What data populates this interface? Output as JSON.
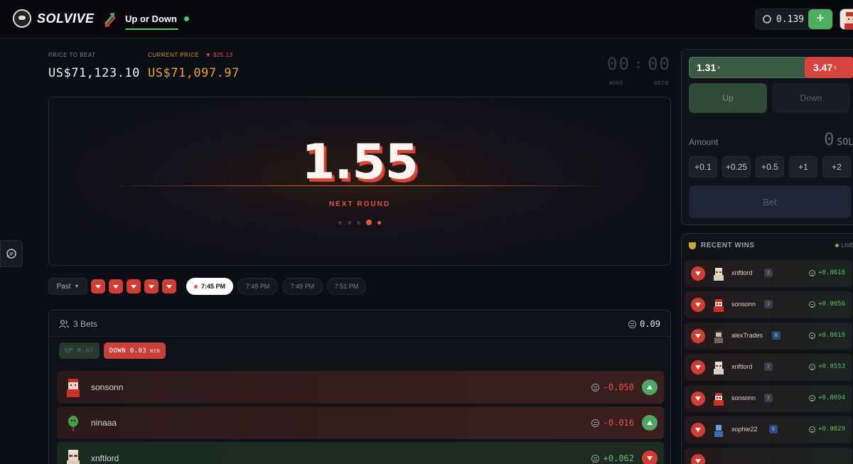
{
  "header": {
    "logo_text": "SOLVIVE",
    "game_title": "Up or Down",
    "wallet_balance": "0.139",
    "add_label": "+"
  },
  "prices": {
    "price_to_beat_label": "PRICE TO BEAT",
    "price_to_beat": "US$71,123.10",
    "current_price_label": "CURRENT PRICE",
    "current_price_change": "$25.13",
    "current_price": "US$71,097.97"
  },
  "timer": {
    "mins": "00",
    "secs": "00",
    "separator": ":",
    "mins_label": "MINS",
    "secs_label": "SECS"
  },
  "round": {
    "multiplier": "1.55",
    "status": "NEXT ROUND"
  },
  "rounds_strip": {
    "past_label": "Past",
    "past_results": [
      "down",
      "down",
      "down",
      "down",
      "down"
    ],
    "times": [
      {
        "label": "7:45 PM",
        "active": true
      },
      {
        "label": "7:48 PM",
        "active": false
      },
      {
        "label": "7:49 PM",
        "active": false
      },
      {
        "label": "7:51 PM",
        "active": false
      }
    ]
  },
  "bets": {
    "count_label": "3 Bets",
    "total": "0.09",
    "up_tag": "UP 0.07",
    "down_tag": "DOWN 0.03",
    "down_tag_win": "WIN",
    "rows": [
      {
        "name": "sonsonn",
        "amount": "-0.050",
        "side": "down",
        "direction": "up"
      },
      {
        "name": "ninaaa",
        "amount": "-0.016",
        "side": "down",
        "direction": "up"
      },
      {
        "name": "xnftlord",
        "amount": "+0.062",
        "side": "up",
        "direction": "down"
      }
    ]
  },
  "side_panel": {
    "up_multiplier": "1.31",
    "down_multiplier": "3.47",
    "mult_suffix": "x",
    "up_label": "Up",
    "down_label": "Down",
    "amount_label": "Amount",
    "amount_value": "0",
    "amount_unit": "SOL",
    "quick_amounts": [
      "+0.1",
      "+0.25",
      "+0.5",
      "+1",
      "+2"
    ],
    "bet_label": "Bet"
  },
  "recent_wins": {
    "title": "RECENT WINS",
    "live_label": "LIVE",
    "rows": [
      {
        "name": "xnftlord",
        "level": "2",
        "amount": "+0.0618",
        "level_color": "gray"
      },
      {
        "name": "sonsonn",
        "level": "2",
        "amount": "+0.0056",
        "level_color": "gray"
      },
      {
        "name": "alexTrades",
        "level": "6",
        "amount": "+0.0019",
        "level_color": "blue"
      },
      {
        "name": "xnftlord",
        "level": "2",
        "amount": "+0.0553",
        "level_color": "gray"
      },
      {
        "name": "sonsonn",
        "level": "2",
        "amount": "+0.0094",
        "level_color": "gray"
      },
      {
        "name": "sophie22",
        "level": "6",
        "amount": "+0.0029",
        "level_color": "blue"
      }
    ]
  },
  "colors": {
    "accent_green": "#4caf60",
    "accent_red": "#d03d37",
    "background": "#0c0e15"
  }
}
